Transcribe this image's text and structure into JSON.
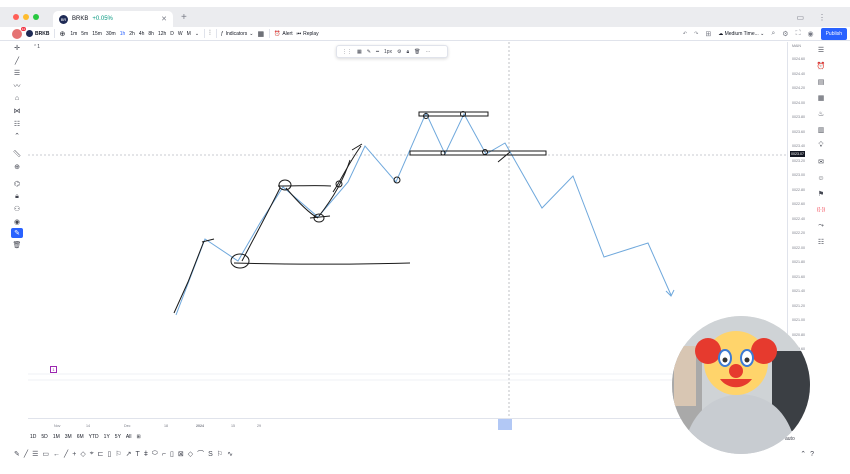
{
  "window": {
    "tab_title": "BRKB",
    "tab_change": "+0.05%",
    "tab_logo": "BR",
    "traffic_lights": [
      "#ff5f57",
      "#febc2e",
      "#28c840"
    ]
  },
  "toolbar": {
    "symbol": "BRKB",
    "avatar_badge": "11",
    "intervals": [
      "1m",
      "5m",
      "15m",
      "30m",
      "1h",
      "2h",
      "4h",
      "8h",
      "12h",
      "D",
      "W",
      "M"
    ],
    "active_interval": "1h",
    "indicators_label": "Indicators",
    "alert_label": "Alert",
    "replay_label": "Replay",
    "layout_label": "Medium Time...",
    "publish_label": "Publish"
  },
  "chart": {
    "pane_label": "1",
    "price_axis_title": "MAIN",
    "price_labels": [
      "0024.60",
      "0024.40",
      "0024.20",
      "0024.00",
      "0023.80",
      "0023.60",
      "0023.40",
      "0023.20",
      "0023.00",
      "0022.80",
      "0022.60",
      "0022.40",
      "0022.20",
      "0022.00",
      "0021.80",
      "0021.60",
      "0021.40",
      "0021.20",
      "0021.00",
      "0020.80",
      "0020.60"
    ],
    "current_price": "0023.07",
    "time_labels": [
      "Nov",
      "14",
      "Dec",
      "18",
      "2024",
      "15",
      "29"
    ],
    "panel_tag": "1",
    "auto_label": "auto",
    "colors": {
      "line": "#6fa8dc",
      "sketch": "#1a1a1a",
      "crosshair": "#9598a1"
    }
  },
  "floating_toolbar": {
    "stroke_label": "1px"
  },
  "range_buttons": [
    "1D",
    "5D",
    "1M",
    "3M",
    "6M",
    "YTD",
    "1Y",
    "5Y",
    "All"
  ],
  "left_icons": [
    "crosshair-icon",
    "trendline-icon",
    "fib-icon",
    "brush-icon",
    "pattern-icon",
    "forecast-icon",
    "text-icon",
    "chevron-up-icon",
    "ruler-icon",
    "zoom-icon",
    "magnet-icon",
    "lock-icon",
    "visibility-icon",
    "eye-icon",
    "favorites-icon",
    "trash-icon"
  ],
  "right_icons": [
    "watchlist-icon",
    "alerts-icon",
    "news-icon",
    "calendar-icon",
    "hotlist-icon",
    "data-icon",
    "ideas-icon",
    "chat-icon",
    "community-icon",
    "pine-icon",
    "signal-icon",
    "scan-icon",
    "screener-icon"
  ],
  "bottom_icons": [
    "pencil-icon",
    "lines-icon",
    "rect-icon",
    "arrow-left-icon",
    "line-icon",
    "plus-icon",
    "diamond-icon",
    "brackets-icon",
    "book-icon",
    "flag-icon",
    "path-icon",
    "triangle-icon",
    "text-t-icon",
    "caret-icon",
    "ellipse-icon",
    "callout-icon",
    "price-icon",
    "ruler-icon",
    "pattern-icon",
    "curve-icon",
    "s-curve-icon",
    "flag2-icon",
    "note-icon",
    "zigzag-icon"
  ]
}
